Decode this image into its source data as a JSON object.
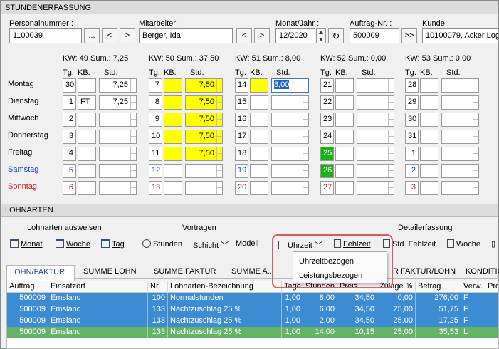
{
  "sections": {
    "stunden": "STUNDENERFASSUNG",
    "lohnarten": "LOHNARTEN"
  },
  "header": {
    "personal_label": "Personalnummer :",
    "personal_value": "1100039",
    "mitarbeiter_label": "Mitarbeiter :",
    "mitarbeiter_value": "Berger, Ida",
    "monat_label": "Monat/Jahr :",
    "monat_value": "12/2020",
    "auftrag_label": "Auftrag-Nr. :",
    "auftrag_value": "500009",
    "kunde_label": "Kunde :",
    "kunde_value": "10100079, Acker Log",
    "btn_dots": "...",
    "btn_prev": "<",
    "btn_next": ">",
    "btn_last": ">>"
  },
  "days": [
    {
      "name": "Montag",
      "color": "black"
    },
    {
      "name": "Dienstag",
      "color": "black"
    },
    {
      "name": "Mittwoch",
      "color": "black"
    },
    {
      "name": "Donnerstag",
      "color": "black"
    },
    {
      "name": "Freitag",
      "color": "black"
    },
    {
      "name": "Samstag",
      "color": "blue"
    },
    {
      "name": "Sonntag",
      "color": "red"
    }
  ],
  "weeks": [
    {
      "kw": "KW: 49",
      "sum": "Sum.: 7,25",
      "days": [
        {
          "tg": "30",
          "kb": "",
          "std": "7,25"
        },
        {
          "tg": "1",
          "kb": "FT",
          "std": "7,25"
        },
        {
          "tg": "2",
          "kb": "",
          "std": ""
        },
        {
          "tg": "3",
          "kb": "",
          "std": ""
        },
        {
          "tg": "4",
          "kb": "",
          "std": ""
        },
        {
          "tg": "5",
          "kb": "",
          "std": ""
        },
        {
          "tg": "6",
          "kb": "",
          "std": ""
        }
      ]
    },
    {
      "kw": "KW: 50",
      "sum": "Sum.: 37,50",
      "days": [
        {
          "tg": "7",
          "kb": "",
          "std": "7,50"
        },
        {
          "tg": "8",
          "kb": "",
          "std": "7,50"
        },
        {
          "tg": "9",
          "kb": "",
          "std": "7,50"
        },
        {
          "tg": "10",
          "kb": "",
          "std": "7,50"
        },
        {
          "tg": "11",
          "kb": "",
          "std": "7,50"
        },
        {
          "tg": "12",
          "kb": "",
          "std": ""
        },
        {
          "tg": "13",
          "kb": "",
          "std": ""
        }
      ]
    },
    {
      "kw": "KW: 51",
      "sum": "Sum.: 8,00",
      "days": [
        {
          "tg": "14",
          "kb": "",
          "std": "8,00"
        },
        {
          "tg": "15",
          "kb": "",
          "std": ""
        },
        {
          "tg": "16",
          "kb": "",
          "std": ""
        },
        {
          "tg": "17",
          "kb": "",
          "std": ""
        },
        {
          "tg": "18",
          "kb": "",
          "std": ""
        },
        {
          "tg": "19",
          "kb": "",
          "std": ""
        },
        {
          "tg": "20",
          "kb": "",
          "std": ""
        }
      ]
    },
    {
      "kw": "KW: 52",
      "sum": "Sum.: 0,00",
      "days": [
        {
          "tg": "21",
          "kb": "",
          "std": ""
        },
        {
          "tg": "22",
          "kb": "",
          "std": ""
        },
        {
          "tg": "23",
          "kb": "",
          "std": ""
        },
        {
          "tg": "24",
          "kb": "",
          "std": ""
        },
        {
          "tg": "25",
          "kb": "",
          "std": ""
        },
        {
          "tg": "26",
          "kb": "",
          "std": ""
        },
        {
          "tg": "27",
          "kb": "",
          "std": ""
        }
      ]
    },
    {
      "kw": "KW: 53",
      "sum": "Sum.: 0,00",
      "days": [
        {
          "tg": "28",
          "kb": "",
          "std": ""
        },
        {
          "tg": "29",
          "kb": "",
          "std": ""
        },
        {
          "tg": "30",
          "kb": "",
          "std": ""
        },
        {
          "tg": "31",
          "kb": "",
          "std": ""
        },
        {
          "tg": "1",
          "kb": "",
          "std": ""
        },
        {
          "tg": "2",
          "kb": "",
          "std": ""
        },
        {
          "tg": "3",
          "kb": "",
          "std": ""
        }
      ]
    }
  ],
  "col_labels": {
    "tg": "Tg.",
    "kb": "KB.",
    "std": "Std."
  },
  "toolbar": {
    "group1": "Lohnarten ausweisen",
    "group2": "Vortragen",
    "group3": "Detailerfassung",
    "monat": "Monat",
    "woche": "Woche",
    "tag": "Tag",
    "stunden": "Stunden",
    "schicht": "Schicht",
    "modell": "Modell",
    "uhrzeit": "Uhrzeit",
    "fehlzeit": "Fehlzeit",
    "std_fehlzeit": "Std. Fehlzeit",
    "woche2": "Woche"
  },
  "dropdown": {
    "item1": "Uhrzeitbezogen",
    "item2": "Leistungsbezogen"
  },
  "tabs": [
    "LOHN/FAKTUR",
    "SUMME LOHN",
    "SUMME FAKTUR",
    "SUMME A...",
    "R FAKTUR/LOHN",
    "KONDITIO"
  ],
  "table": {
    "headers": [
      "Auftrag",
      "Einsatzort",
      "Nr.",
      "Lohnarten-Bezeichnung",
      "Tage",
      "Stunden",
      "Preis",
      "Zulage %",
      "Betrag",
      "Verw.",
      "Pro"
    ],
    "rows": [
      [
        "500009",
        "Emsland",
        "100",
        "Normalstunden",
        "1,00",
        "8,00",
        "34,50",
        "0,00",
        "276,00",
        "F"
      ],
      [
        "500009",
        "Emsland",
        "133",
        "Nachtzuschlag 25 %",
        "1,00",
        "6,00",
        "34,50",
        "25,00",
        "51,75",
        "F"
      ],
      [
        "500009",
        "Emsland",
        "133",
        "Nachtzuschlag 25 %",
        "1,00",
        "2,00",
        "34,50",
        "25,00",
        "17,25",
        "F"
      ],
      [
        "500009",
        "Emsland",
        "133",
        "Nachtzuschlag 25 %",
        "1,00",
        "14,00",
        "10,15",
        "25,00",
        "35,53",
        "L"
      ]
    ]
  },
  "colors": {
    "selected": "#3c8cd4",
    "green_row": "#64b464",
    "yellow": "#ffff00",
    "green_cell": "#17b317",
    "highlight": "#e05a5a"
  }
}
